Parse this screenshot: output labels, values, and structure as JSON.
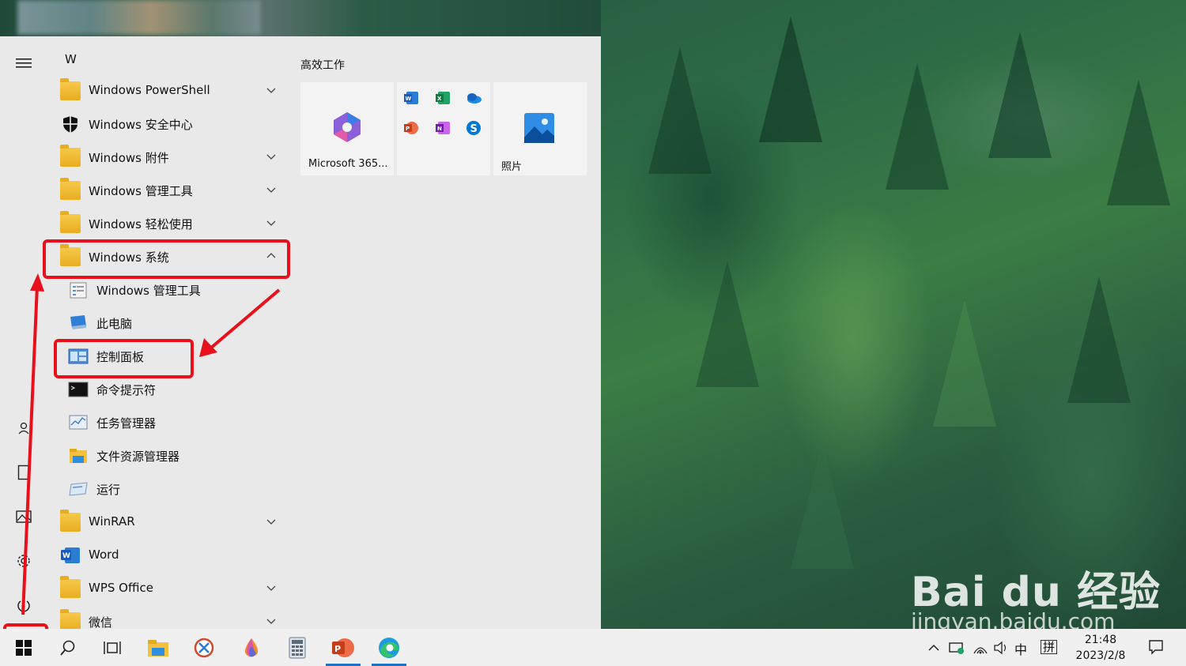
{
  "start_menu": {
    "letter_header": "W",
    "apps": [
      {
        "label": "Windows PowerShell",
        "icon": "folder-icon",
        "expandable": true
      },
      {
        "label": "Windows 安全中心",
        "icon": "shield-icon",
        "expandable": false
      },
      {
        "label": "Windows 附件",
        "icon": "folder-icon",
        "expandable": true
      },
      {
        "label": "Windows 管理工具",
        "icon": "folder-icon",
        "expandable": true
      },
      {
        "label": "Windows 轻松使用",
        "icon": "folder-icon",
        "expandable": true
      },
      {
        "label": "Windows 系统",
        "icon": "folder-icon",
        "expandable": true,
        "expanded": true
      },
      {
        "label": "Windows 管理工具",
        "icon": "admin-tools-icon",
        "sub": true
      },
      {
        "label": "此电脑",
        "icon": "this-pc-icon",
        "sub": true
      },
      {
        "label": "控制面板",
        "icon": "control-panel-icon",
        "sub": true
      },
      {
        "label": "命令提示符",
        "icon": "command-prompt-icon",
        "sub": true
      },
      {
        "label": "任务管理器",
        "icon": "task-manager-icon",
        "sub": true
      },
      {
        "label": "文件资源管理器",
        "icon": "file-explorer-icon",
        "sub": true
      },
      {
        "label": "运行",
        "icon": "run-icon",
        "sub": true
      },
      {
        "label": "WinRAR",
        "icon": "folder-icon",
        "expandable": true
      },
      {
        "label": "Word",
        "icon": "word-icon",
        "expandable": false
      },
      {
        "label": "WPS Office",
        "icon": "folder-icon",
        "expandable": true
      },
      {
        "label": "微信",
        "icon": "folder-icon",
        "expandable": true
      }
    ],
    "pinned_group_title": "高效工作",
    "tiles": [
      {
        "label": "Microsoft 365...",
        "icon": "microsoft-365-icon"
      },
      {
        "label": "",
        "icon": "office-apps-folder-icon"
      },
      {
        "label": "照片",
        "icon": "photos-icon"
      }
    ]
  },
  "taskbar": {
    "clock_time": "21:48",
    "clock_date": "2023/2/8",
    "ime_language": "中",
    "ime_mode": "拼"
  },
  "watermark": {
    "brand": "Bai du 经验",
    "url": "jingyan.baidu.com"
  },
  "colors": {
    "highlight": "#e8101a",
    "menu_bg": "#e9e9e9",
    "taskbar_bg": "#f0f0f0",
    "accent": "#1a73c4"
  }
}
